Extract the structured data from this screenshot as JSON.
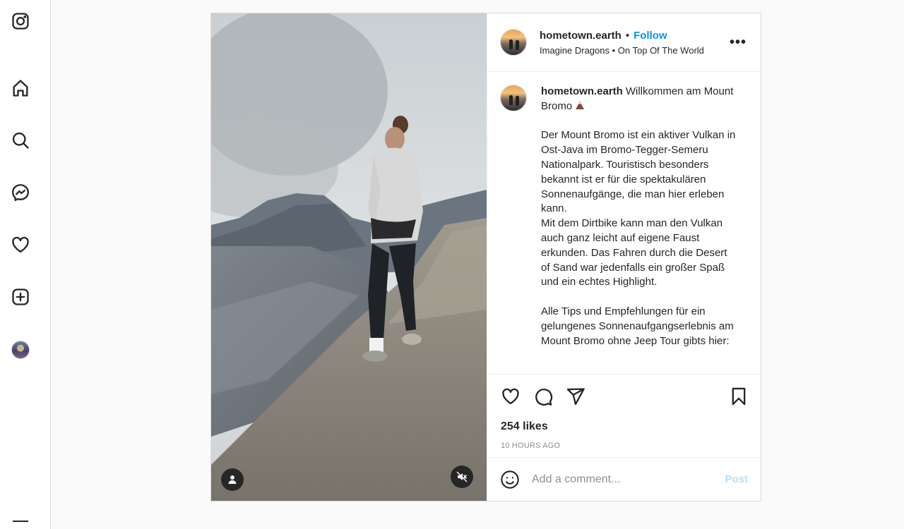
{
  "rail": {
    "items": [
      "instagram-icon",
      "home-icon",
      "search-icon",
      "messenger-icon",
      "heart-icon",
      "create-icon",
      "profile-avatar"
    ]
  },
  "post": {
    "username": "hometown.earth",
    "separator": "•",
    "follow_label": "Follow",
    "audio": "Imagine Dragons • On Top Of The World",
    "more_label": "•••",
    "caption_text": "Willkommen am Mount Bromo",
    "caption_body": "\n\nDer Mount Bromo ist ein aktiver Vulkan in Ost-Java im Bromo-Tegger-Semeru Nationalpark. Touristisch besonders bekannt ist er für die spektakulären Sonnenaufgänge, die man hier erleben kann.\nMit dem Dirtbike kann man den Vulkan auch ganz leicht auf eigene Faust erkunden. Das Fahren durch die Desert of Sand war jedenfalls ein großer Spaß und ein echtes Highlight.\n\nAlle Tips und Empfehlungen für ein gelungenes Sonnenaufgangserlebnis am Mount Bromo ohne Jeep Tour gibts hier:",
    "likes": "254 likes",
    "time_ago": "10 HOURS AGO"
  },
  "comment": {
    "placeholder": "Add a comment...",
    "post_label": "Post"
  },
  "colors": {
    "accent": "#0095f6",
    "post_disabled": "#b2dffc",
    "border": "#dbdbdb"
  }
}
